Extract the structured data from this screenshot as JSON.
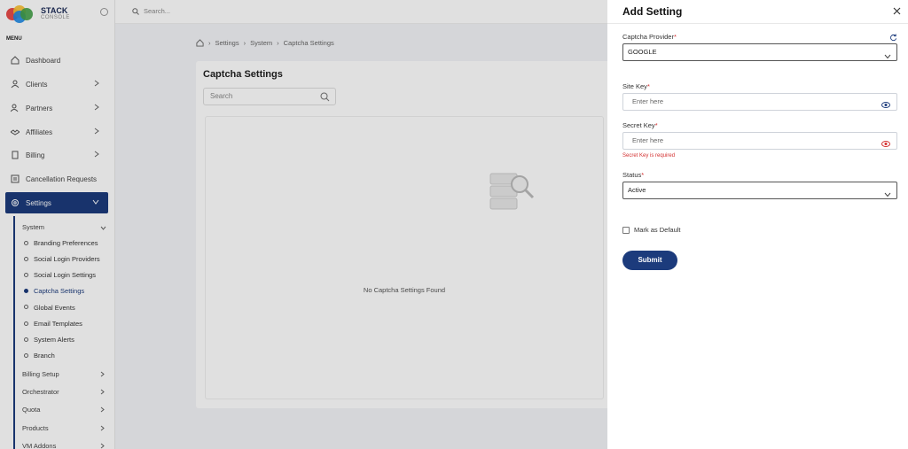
{
  "app": {
    "brand_name": "STACK",
    "brand_sub": "CONSOLE"
  },
  "sidebar": {
    "menu_title": "MENU",
    "items": [
      {
        "label": "Dashboard",
        "icon": "home-icon"
      },
      {
        "label": "Clients",
        "icon": "user-icon"
      },
      {
        "label": "Partners",
        "icon": "users-icon"
      },
      {
        "label": "Affiliates",
        "icon": "handshake-icon"
      },
      {
        "label": "Billing",
        "icon": "document-icon"
      },
      {
        "label": "Cancellation Requests",
        "icon": "list-icon"
      },
      {
        "label": "Settings",
        "icon": "gear-icon"
      }
    ],
    "settings_sub": [
      {
        "label": "System"
      },
      {
        "label": "Billing Setup"
      },
      {
        "label": "Orchestrator"
      },
      {
        "label": "Quota"
      },
      {
        "label": "Products"
      },
      {
        "label": "VM Addons"
      }
    ],
    "system_leaves": [
      {
        "label": "Branding Preferences"
      },
      {
        "label": "Social Login Providers"
      },
      {
        "label": "Social Login Settings"
      },
      {
        "label": "Captcha Settings"
      },
      {
        "label": "Global Events"
      },
      {
        "label": "Email Templates"
      },
      {
        "label": "System Alerts"
      },
      {
        "label": "Branch"
      }
    ]
  },
  "topbar": {
    "search_placeholder": "Search..."
  },
  "breadcrumb": [
    "Settings",
    "System",
    "Captcha Settings"
  ],
  "page": {
    "title": "Captcha Settings",
    "search_placeholder": "Search",
    "empty_text": "No Captcha Settings Found"
  },
  "drawer": {
    "title": "Add Setting",
    "captcha_provider": {
      "label": "Captcha Provider",
      "value": "GOOGLE"
    },
    "site_key": {
      "label": "Site Key",
      "placeholder": "Enter here"
    },
    "secret_key": {
      "label": "Secret Key",
      "placeholder": "Enter here",
      "error": "Secret Key is required"
    },
    "status": {
      "label": "Status",
      "value": "Active"
    },
    "default_label": "Mark as Default",
    "submit_label": "Submit",
    "required_mark": "*"
  },
  "colors": {
    "primary": "#1c3b7c",
    "error": "#d32f2f"
  }
}
